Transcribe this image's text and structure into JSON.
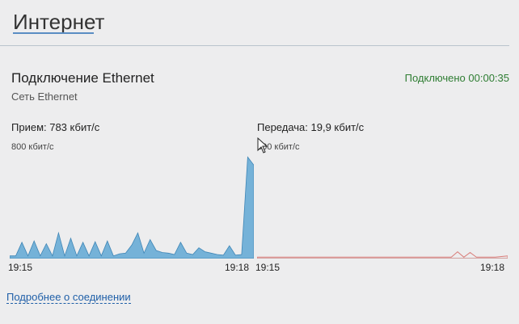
{
  "page": {
    "title": "Интернет"
  },
  "connection": {
    "name": "Подключение Ethernet",
    "network": "Сеть Ethernet",
    "status": "Подключено 00:00:35"
  },
  "receive": {
    "label": "Прием: 783 кбит/с",
    "scale": "800 кбит/с",
    "time_start": "19:15",
    "time_end": "19:18",
    "color": "#5fa7d3",
    "values": [
      20,
      20,
      120,
      20,
      130,
      20,
      110,
      20,
      190,
      20,
      150,
      20,
      120,
      20,
      125,
      20,
      130,
      20,
      35,
      40,
      100,
      190,
      40,
      140,
      60,
      45,
      40,
      30,
      120,
      40,
      30,
      80,
      50,
      40,
      30,
      25,
      95,
      25,
      30,
      750,
      690
    ]
  },
  "transmit": {
    "label": "Передача: 19,9 кбит/с",
    "scale": "800 кбит/с",
    "time_start": "19:15",
    "time_end": "19:18",
    "color": "#d97c78",
    "values": [
      10,
      10,
      10,
      10,
      10,
      10,
      10,
      10,
      10,
      10,
      10,
      10,
      10,
      10,
      10,
      10,
      10,
      10,
      10,
      10,
      10,
      10,
      10,
      10,
      10,
      10,
      10,
      10,
      10,
      10,
      10,
      10,
      50,
      10,
      45,
      10,
      10,
      10,
      10,
      15,
      20
    ]
  },
  "links": {
    "details": "Подробнее о соединении"
  },
  "colors": {
    "accent": "#5a8dc3",
    "status_ok": "#2e7d32",
    "link": "#1f5fa8"
  }
}
